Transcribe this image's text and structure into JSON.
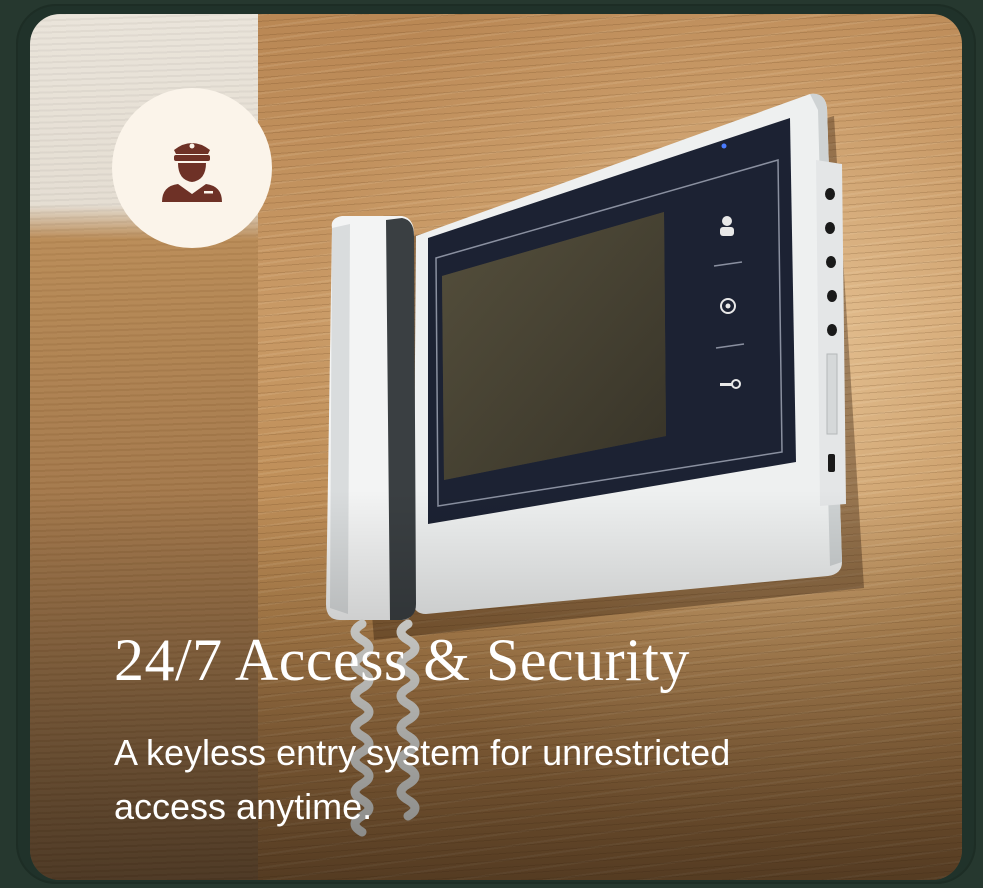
{
  "card": {
    "title": "24/7 Access & Security",
    "description": "A keyless entry system for unrestricted access anytime.",
    "icon": "security-guard-icon"
  },
  "colors": {
    "frame": "#26382f",
    "badge_bg": "#fbf4ea",
    "icon": "#6e3126",
    "text": "#ffffff"
  }
}
